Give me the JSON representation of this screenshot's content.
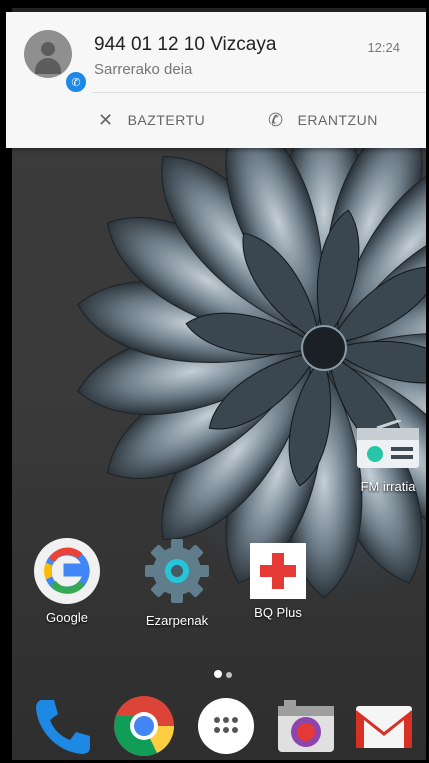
{
  "notification": {
    "caller": "944 01 12 10 Vizcaya",
    "subtitle": "Sarrerako deia",
    "time": "12:24",
    "dismiss_label": "BAZTERTU",
    "answer_label": "ERANTZUN"
  },
  "home_apps": [
    {
      "label": "FM irratia"
    },
    {
      "label": "Google"
    },
    {
      "label": "Ezarpenak"
    },
    {
      "label": "BQ Plus"
    }
  ],
  "page_indicator": {
    "pages": 2,
    "current": 1
  },
  "dock": [
    "phone",
    "chrome",
    "apps",
    "camera",
    "gmail"
  ],
  "colors": {
    "accent": "#1e88e5",
    "bq_red": "#e53935"
  }
}
